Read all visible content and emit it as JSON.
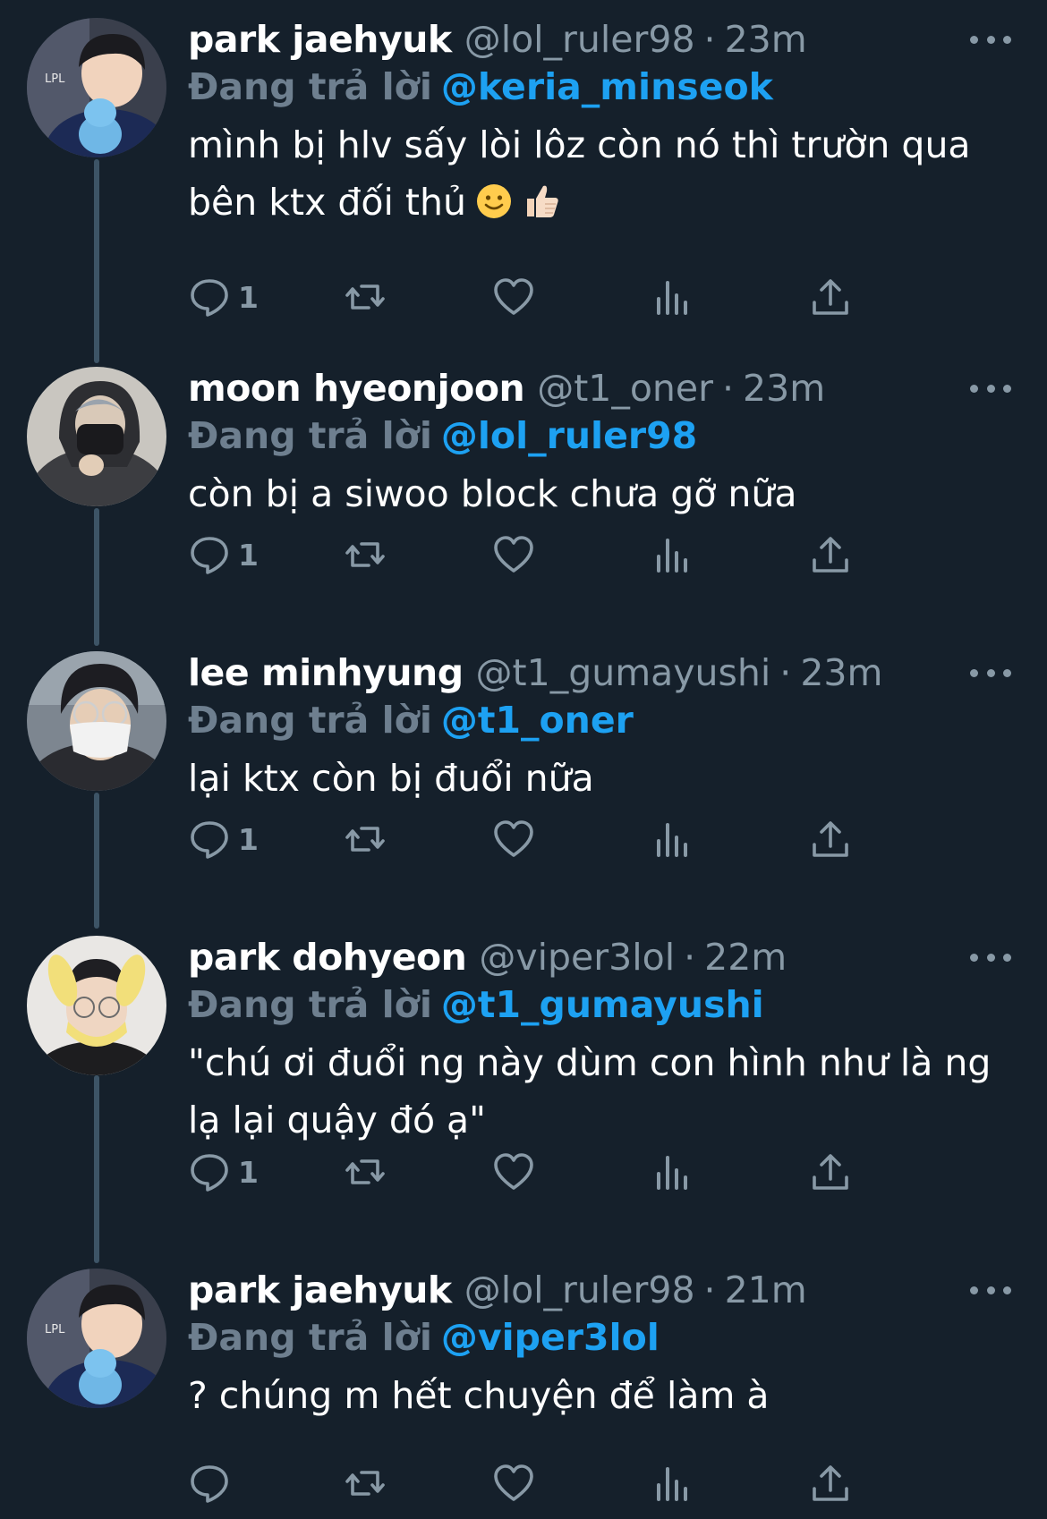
{
  "colors": {
    "background": "#15202b",
    "text": "#ffffff",
    "muted": "#8899a6",
    "accent": "#1da1f2",
    "thread_line": "#3d5466"
  },
  "reply_prefix": "Đang trả lời",
  "tweets": [
    {
      "name": "park jaehyuk",
      "handle": "@lol_ruler98",
      "separator": "·",
      "time": "23m",
      "reply_to": "@keria_minseok",
      "text": "mình bị hlv sấy lòi lôz còn nó thì trườn qua bên ktx đối thủ",
      "emoji": [
        "slightly-smiling-face-emoji",
        "thumbs-up-emoji"
      ],
      "reply_count": "1",
      "avatar_icon": "avatar-park-jaehyuk"
    },
    {
      "name": "moon hyeonjoon",
      "handle": "@t1_oner",
      "separator": "·",
      "time": "23m",
      "reply_to": "@lol_ruler98",
      "text": "còn bị a siwoo block chưa gỡ nữa",
      "emoji": [],
      "reply_count": "1",
      "avatar_icon": "avatar-moon-hyeonjoon"
    },
    {
      "name": "lee minhyung",
      "handle": "@t1_gumayushi",
      "separator": "·",
      "time": "23m",
      "reply_to": "@t1_oner",
      "text": "lại ktx còn bị đuổi nữa",
      "emoji": [],
      "reply_count": "1",
      "avatar_icon": "avatar-lee-minhyung"
    },
    {
      "name": "park dohyeon",
      "handle": "@viper3lol",
      "separator": "·",
      "time": "22m",
      "reply_to": "@t1_gumayushi",
      "text": "\"chú ơi đuổi ng này dùm con hình như là ng lạ lại quậy đó ạ\"",
      "emoji": [],
      "reply_count": "1",
      "avatar_icon": "avatar-park-dohyeon"
    },
    {
      "name": "park jaehyuk",
      "handle": "@lol_ruler98",
      "separator": "·",
      "time": "21m",
      "reply_to": "@viper3lol",
      "text": "? chúng m hết chuyện để làm à",
      "emoji": [],
      "reply_count": "",
      "avatar_icon": "avatar-park-jaehyuk"
    }
  ]
}
